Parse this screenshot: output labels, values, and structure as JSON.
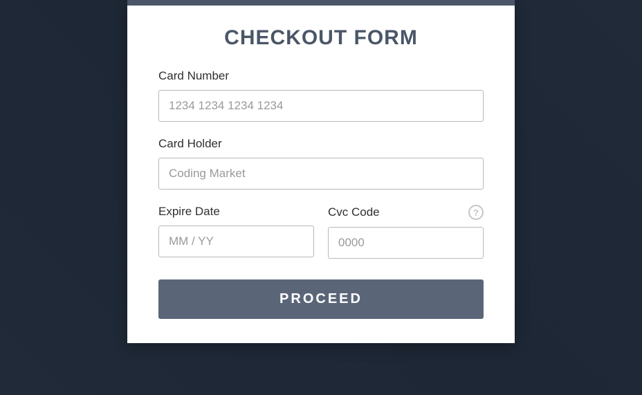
{
  "form": {
    "title": "CHECKOUT FORM",
    "cardNumber": {
      "label": "Card Number",
      "placeholder": "1234 1234 1234 1234",
      "value": ""
    },
    "cardHolder": {
      "label": "Card Holder",
      "placeholder": "Coding Market",
      "value": ""
    },
    "expireDate": {
      "label": "Expire Date",
      "placeholder": "MM / YY",
      "value": ""
    },
    "cvcCode": {
      "label": "Cvc Code",
      "placeholder": "0000",
      "value": "",
      "helpText": "?"
    },
    "submit": {
      "label": "PROCEED"
    }
  }
}
